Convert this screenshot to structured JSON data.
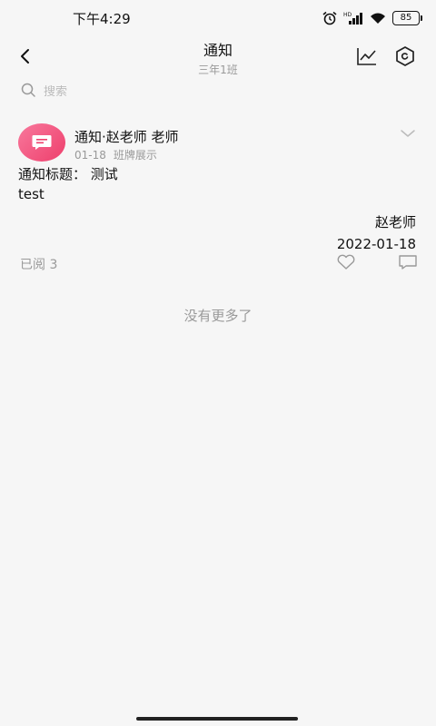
{
  "status_bar": {
    "time": "下午4:29",
    "battery": "85"
  },
  "header": {
    "title": "通知",
    "subtitle": "三年1班"
  },
  "search": {
    "placeholder": "搜索"
  },
  "post": {
    "author": "通知·赵老师 老师",
    "date": "01-18",
    "source": "班牌展示",
    "title_line": "通知标题： 测试",
    "body": "test",
    "signature_name": "赵老师",
    "signature_date": "2022-01-18",
    "read_count": "已阅 3"
  },
  "footer": {
    "end_text": "没有更多了"
  },
  "colors": {
    "avatar_gradient_start": "#f8789c",
    "avatar_gradient_end": "#ee3f6c",
    "muted_text": "#999999",
    "background": "#f6f6f6"
  }
}
